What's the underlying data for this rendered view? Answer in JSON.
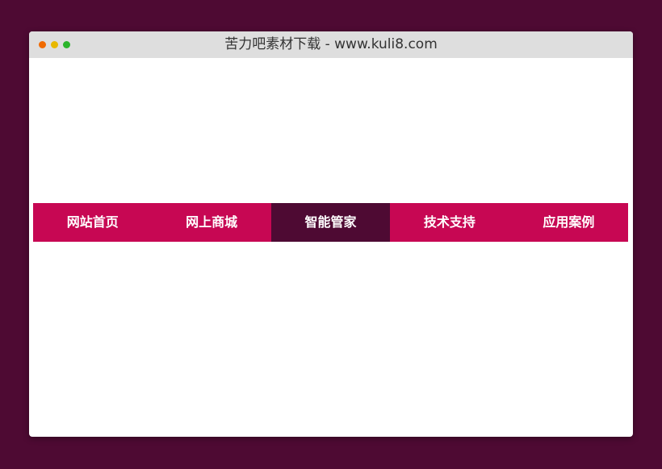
{
  "window": {
    "title": "苦力吧素材下载 - www.kuli8.com",
    "controls": [
      "close-dot",
      "minimize-dot",
      "maximize-dot"
    ]
  },
  "nav": {
    "active_index": 2,
    "items": [
      {
        "label": "网站首页"
      },
      {
        "label": "网上商城"
      },
      {
        "label": "智能管家"
      },
      {
        "label": "技术支持"
      },
      {
        "label": "应用案例"
      }
    ]
  },
  "colors": {
    "page_background": "#4e0a33",
    "nav_background": "#c70753",
    "nav_active": "#4e0a33",
    "nav_text": "#ffffff",
    "titlebar": "#dedede",
    "dot_red": "#f06a00",
    "dot_yellow": "#e8b800",
    "dot_green": "#2bb52b"
  }
}
